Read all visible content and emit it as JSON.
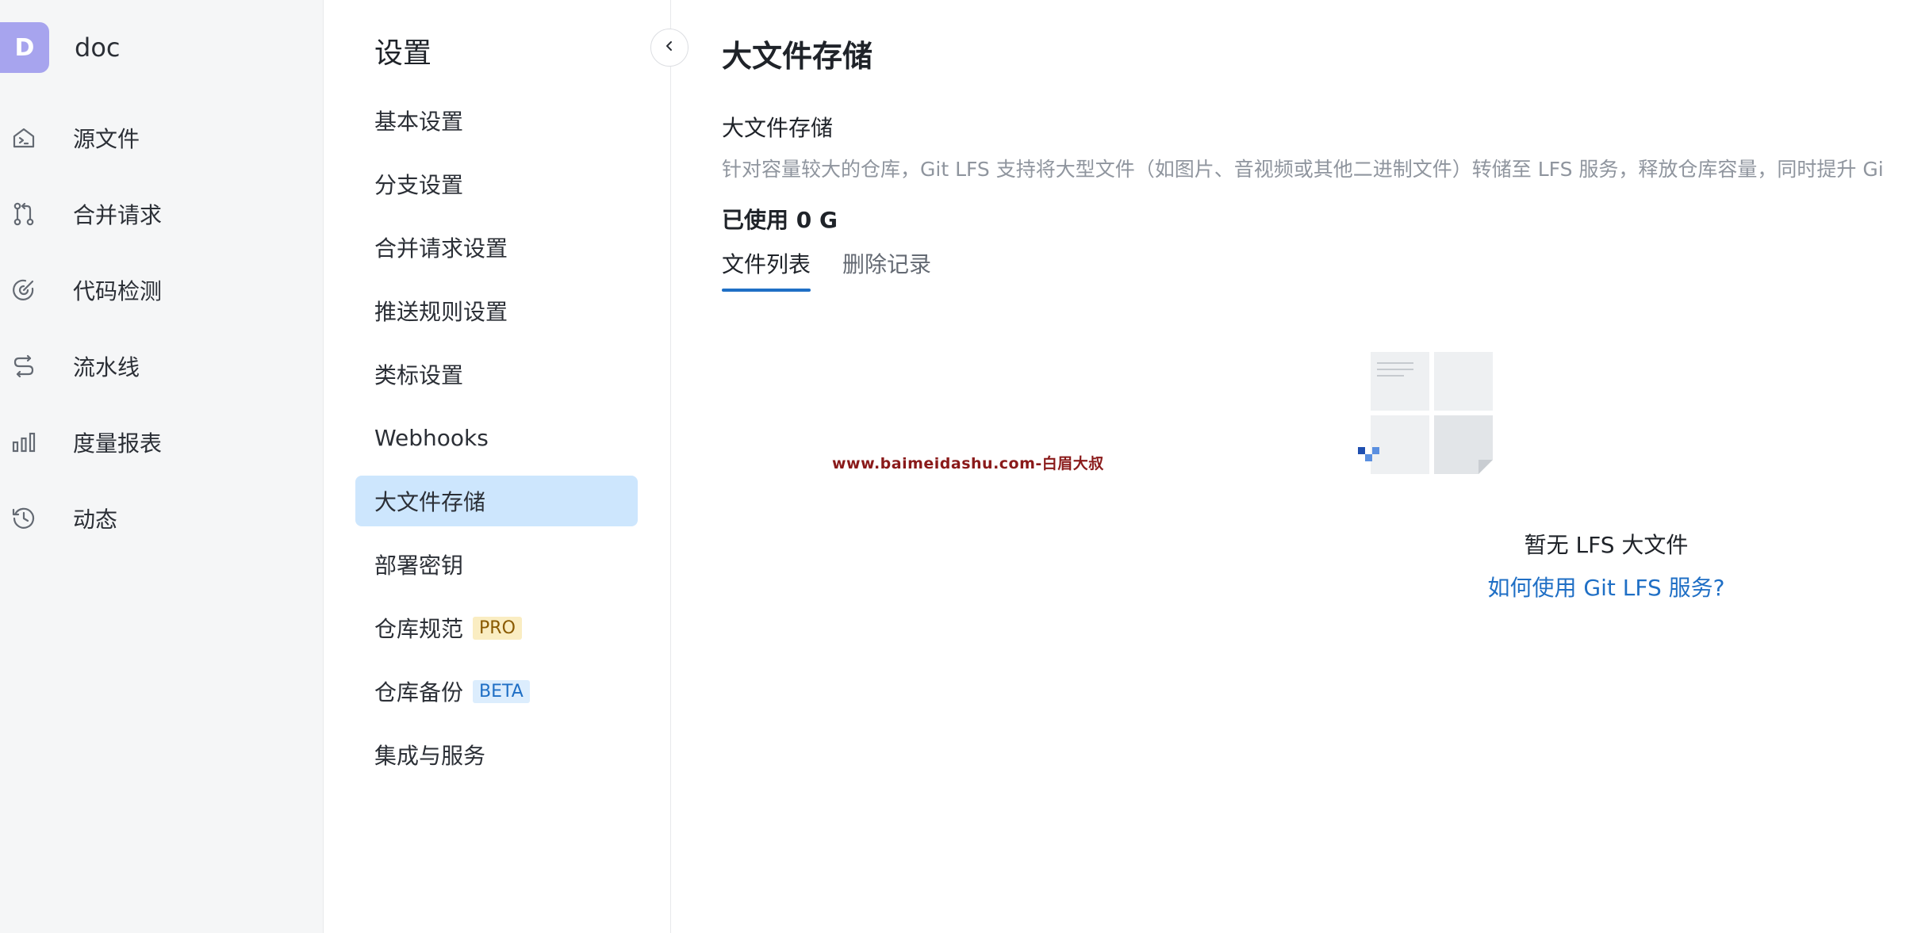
{
  "repo": {
    "avatar_letter": "D",
    "name": "doc"
  },
  "nav": {
    "items": [
      {
        "label": "源文件",
        "icon": "source-file-icon"
      },
      {
        "label": "合并请求",
        "icon": "merge-request-icon"
      },
      {
        "label": "代码检测",
        "icon": "code-scan-icon"
      },
      {
        "label": "流水线",
        "icon": "pipeline-icon"
      },
      {
        "label": "度量报表",
        "icon": "bar-chart-icon"
      },
      {
        "label": "动态",
        "icon": "history-icon"
      }
    ]
  },
  "settings": {
    "title": "设置",
    "menu": [
      {
        "label": "基本设置"
      },
      {
        "label": "分支设置"
      },
      {
        "label": "合并请求设置"
      },
      {
        "label": "推送规则设置"
      },
      {
        "label": "类标设置"
      },
      {
        "label": "Webhooks"
      },
      {
        "label": "大文件存储",
        "active": true
      },
      {
        "label": "部署密钥"
      },
      {
        "label": "仓库规范",
        "badge": "PRO"
      },
      {
        "label": "仓库备份",
        "badge": "BETA"
      },
      {
        "label": "集成与服务"
      }
    ]
  },
  "main": {
    "title": "大文件存储",
    "section_title": "大文件存储",
    "description": "针对容量较大的仓库，Git LFS 支持将大型文件（如图片、音视频或其他二进制文件）转储至 LFS 服务，释放仓库容量，同时提升 Gi",
    "usage": "已使用 0 G",
    "tabs": [
      {
        "label": "文件列表",
        "active": true
      },
      {
        "label": "删除记录"
      }
    ],
    "empty_text": "暂无 LFS 大文件",
    "help_link": "如何使用 Git LFS 服务?"
  },
  "watermark": "www.baimeidashu.com-白眉大叔",
  "colors": {
    "accent": "#1f6fc5",
    "active_bg": "#cde6fd",
    "avatar": "#a7a4ee",
    "pro_badge_bg": "#faedc2",
    "beta_badge_bg": "#dcedfd"
  }
}
